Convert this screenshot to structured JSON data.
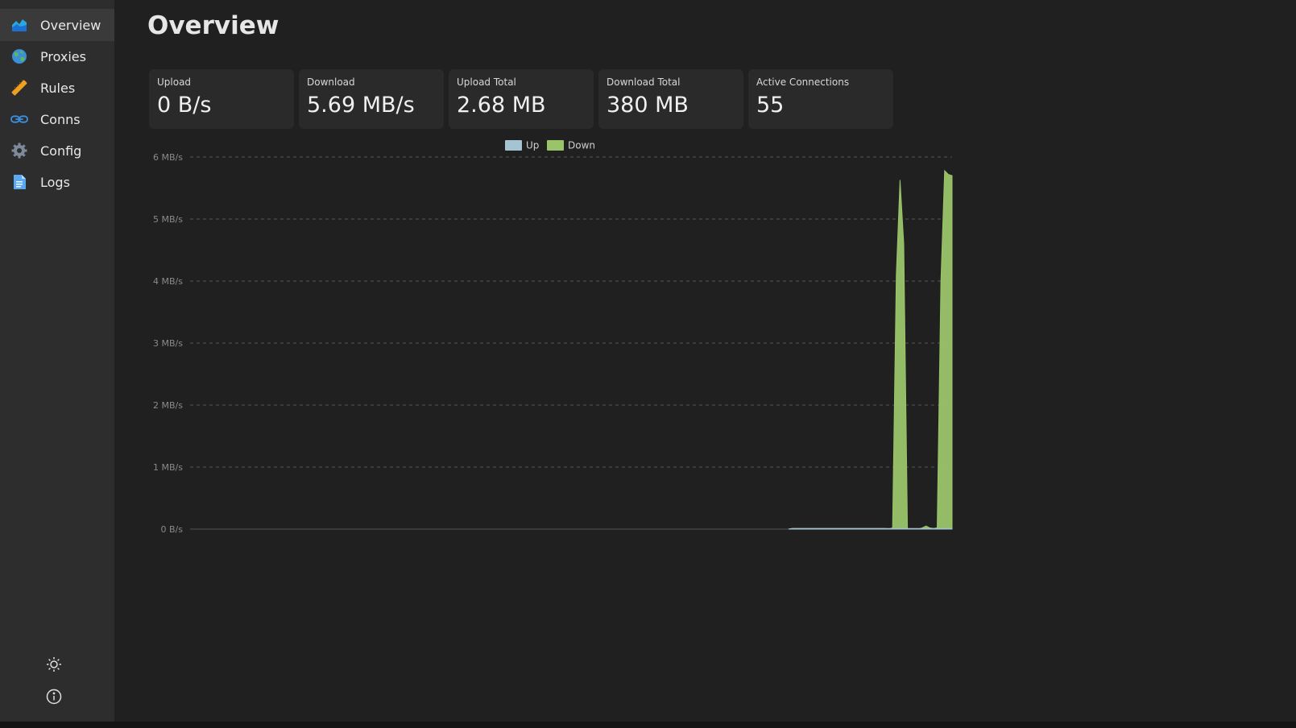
{
  "sidebar": {
    "items": [
      {
        "label": "Overview",
        "icon": "chart-area-icon",
        "active": true
      },
      {
        "label": "Proxies",
        "icon": "globe-icon",
        "active": false
      },
      {
        "label": "Rules",
        "icon": "ruler-icon",
        "active": false
      },
      {
        "label": "Conns",
        "icon": "link-icon",
        "active": false
      },
      {
        "label": "Config",
        "icon": "gear-icon",
        "active": false
      },
      {
        "label": "Logs",
        "icon": "document-icon",
        "active": false
      }
    ],
    "theme_icon": "sun-icon",
    "about_icon": "info-icon"
  },
  "page": {
    "title": "Overview"
  },
  "stats": [
    {
      "label": "Upload",
      "value": "0 B/s"
    },
    {
      "label": "Download",
      "value": "5.69 MB/s"
    },
    {
      "label": "Upload Total",
      "value": "2.68 MB"
    },
    {
      "label": "Download Total",
      "value": "380 MB"
    },
    {
      "label": "Active Connections",
      "value": "55"
    }
  ],
  "colors": {
    "up": "#a4c4d4",
    "down": "#9bc46a",
    "background": "#202020",
    "sidebar": "#2d2d2d"
  },
  "chart_data": {
    "type": "area",
    "legend": [
      "Up",
      "Down"
    ],
    "legend_position": "top-center",
    "yticks": [
      "6 MB/s",
      "5 MB/s",
      "4 MB/s",
      "3 MB/s",
      "2 MB/s",
      "1 MB/s",
      "0 B/s"
    ],
    "ylim": [
      0,
      6
    ],
    "grid": true,
    "series": [
      {
        "name": "Up",
        "values": [
          0,
          0,
          0,
          0,
          0,
          0,
          0,
          0,
          0,
          0,
          0,
          0,
          0,
          0,
          0,
          0,
          0,
          0,
          0,
          0,
          0,
          0,
          0,
          0,
          0,
          0,
          0,
          0,
          0,
          0,
          0,
          0,
          0,
          0,
          0,
          0,
          0,
          0,
          0,
          0,
          0,
          0,
          0,
          0,
          0,
          0,
          0,
          0,
          0,
          0,
          0,
          0,
          0,
          0,
          0,
          0,
          0,
          0,
          0,
          0,
          0,
          0,
          0,
          0,
          0,
          0,
          0,
          0,
          0,
          0,
          0,
          0,
          0,
          0,
          0,
          0,
          0,
          0,
          0,
          0,
          0,
          0,
          0,
          0,
          0,
          0,
          0,
          0,
          0,
          0,
          0,
          0,
          0,
          0,
          0,
          0,
          0,
          0,
          0,
          0,
          0,
          0,
          0,
          0,
          0,
          0,
          0,
          0,
          0,
          0,
          0,
          0,
          0,
          0,
          0,
          0,
          0,
          0,
          0,
          0,
          0,
          0,
          0,
          0,
          0,
          0,
          0,
          0,
          0,
          0,
          0,
          0,
          0,
          0,
          0,
          0,
          0,
          0,
          0,
          0,
          0,
          0,
          0,
          0,
          0,
          0,
          0,
          0,
          0,
          0,
          0,
          0,
          0,
          0,
          0,
          0,
          0,
          0,
          0,
          0,
          0,
          0,
          0.01,
          0.01,
          0.01,
          0.01,
          0.01,
          0.01,
          0.01,
          0.01,
          0.01,
          0.01,
          0.01,
          0.01,
          0.01,
          0.01,
          0.01,
          0.01,
          0.01,
          0.01,
          0.01,
          0.01,
          0.01,
          0.01,
          0.01,
          0.01,
          0.01,
          0.01,
          0.01,
          0.01,
          0.01,
          0.01,
          0.01,
          0.01,
          0.01,
          0.01,
          0.01,
          0.01,
          0.01,
          0.01,
          0.01,
          0.01,
          0.01,
          0.01,
          0.01,
          0.01
        ]
      },
      {
        "name": "Down",
        "values": [
          0,
          0,
          0,
          0,
          0,
          0,
          0,
          0,
          0,
          0,
          0,
          0,
          0,
          0,
          0,
          0,
          0,
          0,
          0,
          0,
          0,
          0,
          0,
          0,
          0,
          0,
          0,
          0,
          0,
          0,
          0,
          0,
          0,
          0,
          0,
          0,
          0,
          0,
          0,
          0,
          0,
          0,
          0,
          0,
          0,
          0,
          0,
          0,
          0,
          0,
          0,
          0,
          0,
          0,
          0,
          0,
          0,
          0,
          0,
          0,
          0,
          0,
          0,
          0,
          0,
          0,
          0,
          0,
          0,
          0,
          0,
          0,
          0,
          0,
          0,
          0,
          0,
          0,
          0,
          0,
          0,
          0,
          0,
          0,
          0,
          0,
          0,
          0,
          0,
          0,
          0,
          0,
          0,
          0,
          0,
          0,
          0,
          0,
          0,
          0,
          0,
          0,
          0,
          0,
          0,
          0,
          0,
          0,
          0,
          0,
          0,
          0,
          0,
          0,
          0,
          0,
          0,
          0,
          0,
          0,
          0,
          0,
          0,
          0,
          0,
          0,
          0,
          0,
          0,
          0,
          0,
          0,
          0,
          0,
          0,
          0,
          0,
          0,
          0,
          0,
          0,
          0,
          0,
          0,
          0,
          0,
          0,
          0,
          0,
          0,
          0,
          0,
          0,
          0,
          0,
          0,
          0,
          0,
          0,
          0,
          0,
          0,
          0.01,
          0.01,
          0.01,
          0.01,
          0.01,
          0.01,
          0.01,
          0.01,
          0.01,
          0.01,
          0.01,
          0.01,
          0.01,
          0.01,
          0.01,
          0.01,
          0.01,
          0.01,
          0.01,
          0.01,
          0.01,
          0.01,
          0.01,
          0.01,
          0.01,
          0.01,
          0,
          0.02,
          4.1,
          5.63,
          4.6,
          0,
          0,
          0,
          0,
          0.02,
          0.05,
          0.02,
          0.01,
          0.02,
          4.0,
          5.78,
          5.72,
          5.7
        ]
      }
    ]
  }
}
